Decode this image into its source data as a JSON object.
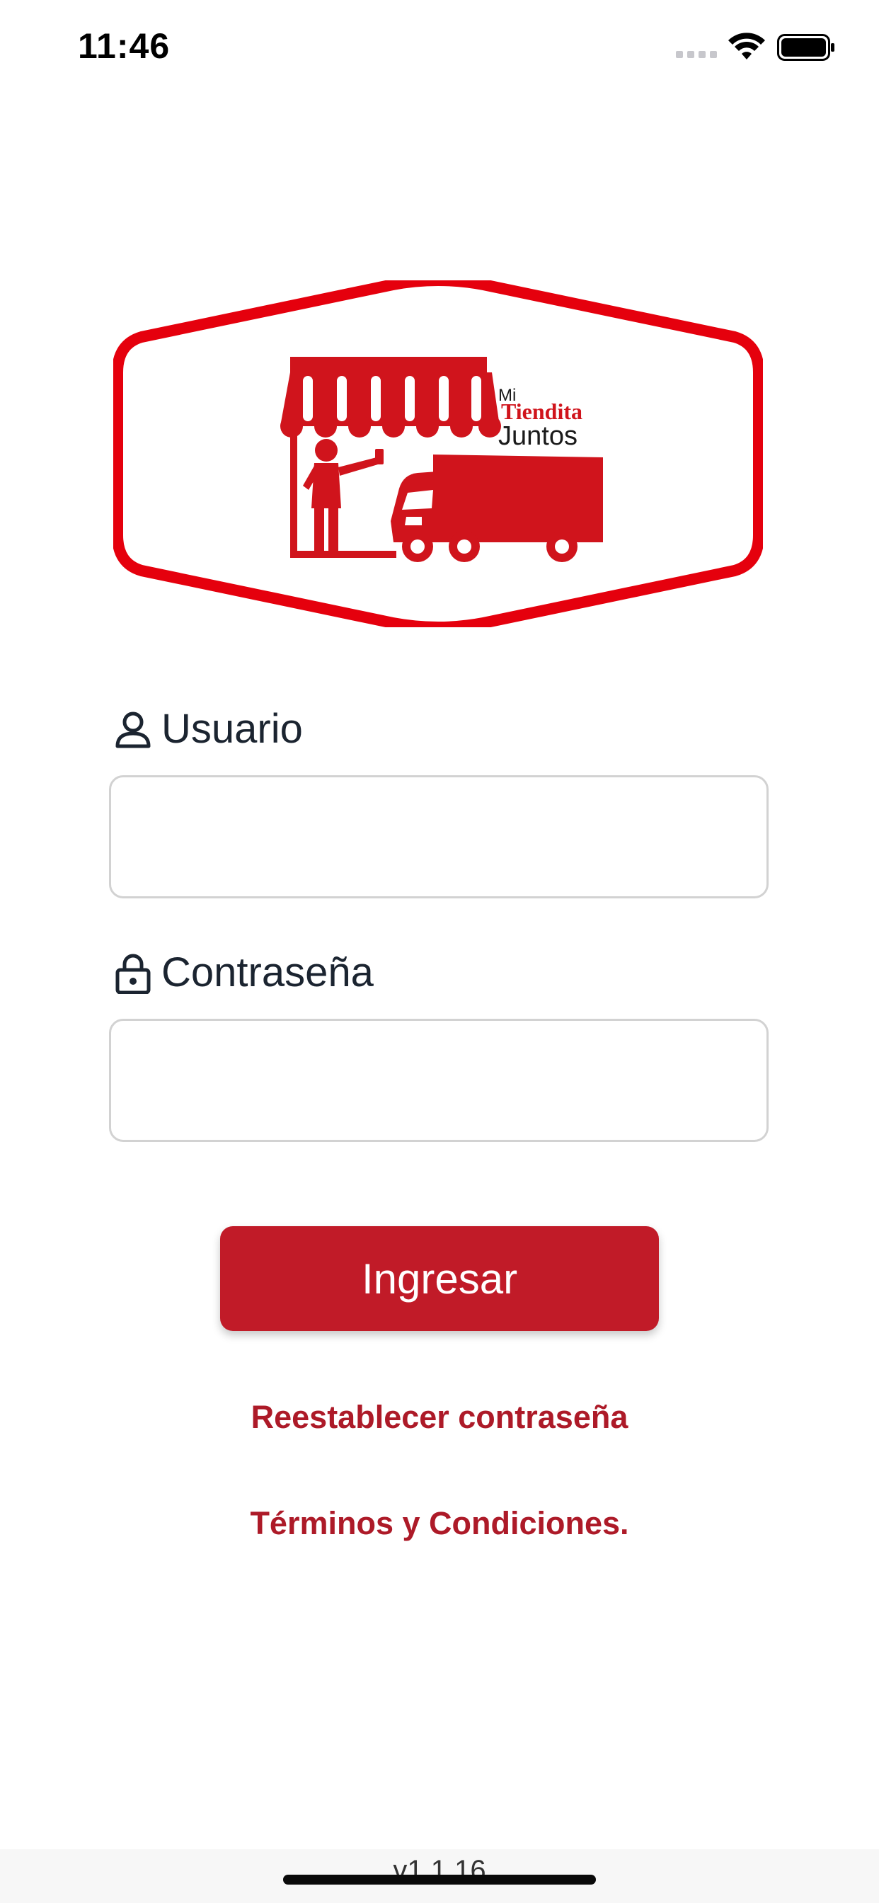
{
  "status_bar": {
    "time": "11:46",
    "icons": [
      "signal-dots-icon",
      "wifi-icon",
      "battery-icon"
    ]
  },
  "logo": {
    "text_line1": "Mi",
    "text_line2": "Tiendita",
    "text_line3": "Juntos",
    "brand_color": "#e5000d"
  },
  "form": {
    "username": {
      "label": "Usuario",
      "icon": "user-icon",
      "value": "",
      "placeholder": ""
    },
    "password": {
      "label": "Contraseña",
      "icon": "lock-icon",
      "value": "",
      "placeholder": ""
    },
    "submit_label": "Ingresar"
  },
  "links": {
    "reset_password": "Reestablecer contraseña",
    "terms": "Términos y Condiciones."
  },
  "footer": {
    "version": "v1.1.16"
  },
  "colors": {
    "primary_button": "#c11b28",
    "link": "#ad1a28",
    "input_border": "#d2d2d2",
    "text": "#1b2430"
  }
}
